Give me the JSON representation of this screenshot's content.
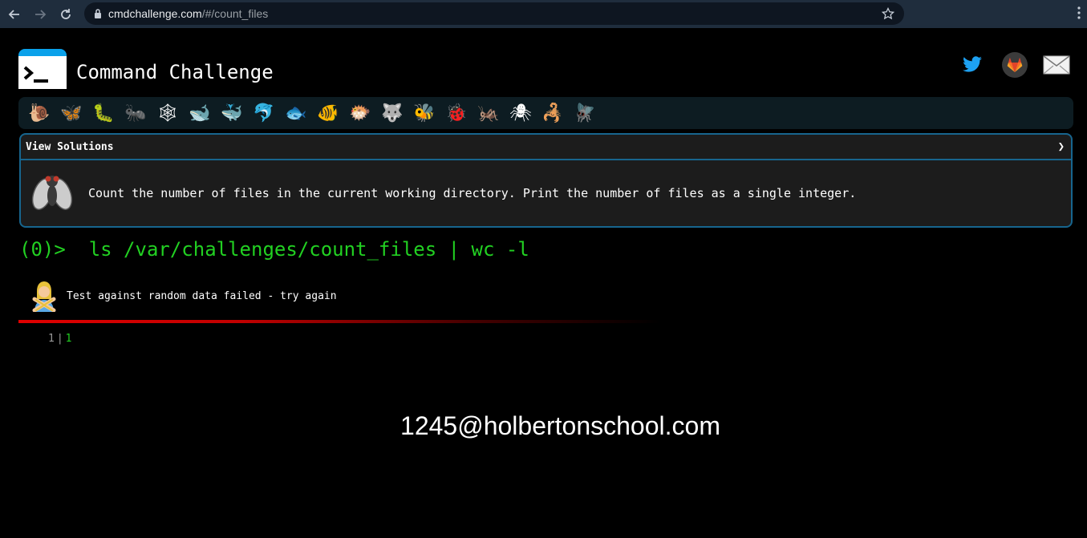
{
  "browser": {
    "url_host": "cmdchallenge.com",
    "url_path": "/#/count_files"
  },
  "header": {
    "title": "Command Challenge"
  },
  "levels": [
    {
      "icon": "snail-icon",
      "glyph": "🐌"
    },
    {
      "icon": "butterfly-icon",
      "glyph": "🦋"
    },
    {
      "icon": "caterpillar-icon",
      "glyph": "🐛"
    },
    {
      "icon": "ant-icon",
      "glyph": "🐜"
    },
    {
      "icon": "spider-web-icon",
      "glyph": "🕸"
    },
    {
      "icon": "whale-icon",
      "glyph": "🐋"
    },
    {
      "icon": "spouting-whale-icon",
      "glyph": "🐳"
    },
    {
      "icon": "dolphin-icon",
      "glyph": "🐬"
    },
    {
      "icon": "fish-icon",
      "glyph": "🐟"
    },
    {
      "icon": "tropical-fish-icon",
      "glyph": "🐠"
    },
    {
      "icon": "blowfish-icon",
      "glyph": "🐡"
    },
    {
      "icon": "wolf-icon",
      "glyph": "🐺"
    },
    {
      "icon": "bee-icon",
      "glyph": "🐝"
    },
    {
      "icon": "ladybug-icon",
      "glyph": "🐞"
    },
    {
      "icon": "cricket-icon",
      "glyph": "🦗"
    },
    {
      "icon": "spider-icon",
      "glyph": "🕷"
    },
    {
      "icon": "scorpion-icon",
      "glyph": "🦂"
    },
    {
      "icon": "fly-icon",
      "glyph": "🪰"
    }
  ],
  "panel": {
    "title": "View Solutions",
    "chevron": "❯",
    "description": "Count the number of files in the current working directory. Print the number of files as a single integer."
  },
  "command": {
    "prompt": "(0)>",
    "text": "ls /var/challenges/count_files | wc -l"
  },
  "result": {
    "message": "Test against random data failed - try again",
    "status_color": "#e00000"
  },
  "output": {
    "line_number": "1",
    "value": "1"
  },
  "overlay": {
    "email": "1245@holbertonschool.com"
  }
}
